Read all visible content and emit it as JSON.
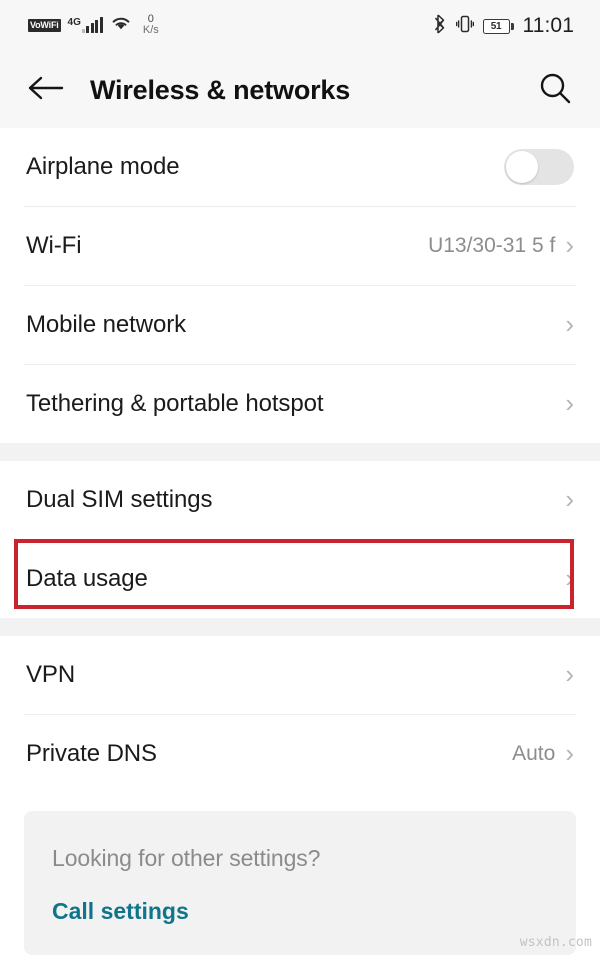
{
  "status_bar": {
    "vowifi_label": "VoWiFi",
    "network_type": "4G",
    "signal_icon": "signal-bars-icon",
    "wifi_icon": "wifi-icon",
    "data_rate_value": "0",
    "data_rate_unit": "K/s",
    "bluetooth_icon": "bluetooth-icon",
    "vibrate_icon": "vibrate-icon",
    "battery_percent": "51",
    "time": "11:01"
  },
  "app_bar": {
    "back_icon": "back-arrow-icon",
    "title": "Wireless & networks",
    "search_icon": "search-icon"
  },
  "sections": [
    {
      "rows": [
        {
          "label": "Airplane mode",
          "value": "",
          "control": "toggle",
          "toggle_on": false
        },
        {
          "label": "Wi-Fi",
          "value": "U13/30-31 5 f",
          "control": "chevron"
        },
        {
          "label": "Mobile network",
          "value": "",
          "control": "chevron"
        },
        {
          "label": "Tethering & portable hotspot",
          "value": "",
          "control": "chevron"
        }
      ]
    },
    {
      "rows": [
        {
          "label": "Dual SIM settings",
          "value": "",
          "control": "chevron"
        },
        {
          "label": "Data usage",
          "value": "",
          "control": "chevron",
          "highlighted": true
        }
      ]
    },
    {
      "rows": [
        {
          "label": "VPN",
          "value": "",
          "control": "chevron"
        },
        {
          "label": "Private DNS",
          "value": "Auto",
          "control": "chevron"
        }
      ]
    }
  ],
  "footer": {
    "question": "Looking for other settings?",
    "link_label": "Call settings"
  },
  "watermark": "wsxdn.com",
  "colors": {
    "accent_link": "#10748a",
    "highlight_border": "#c9232d",
    "section_gap": "#f2f2f3",
    "appbar_bg": "#f7f7f8"
  }
}
